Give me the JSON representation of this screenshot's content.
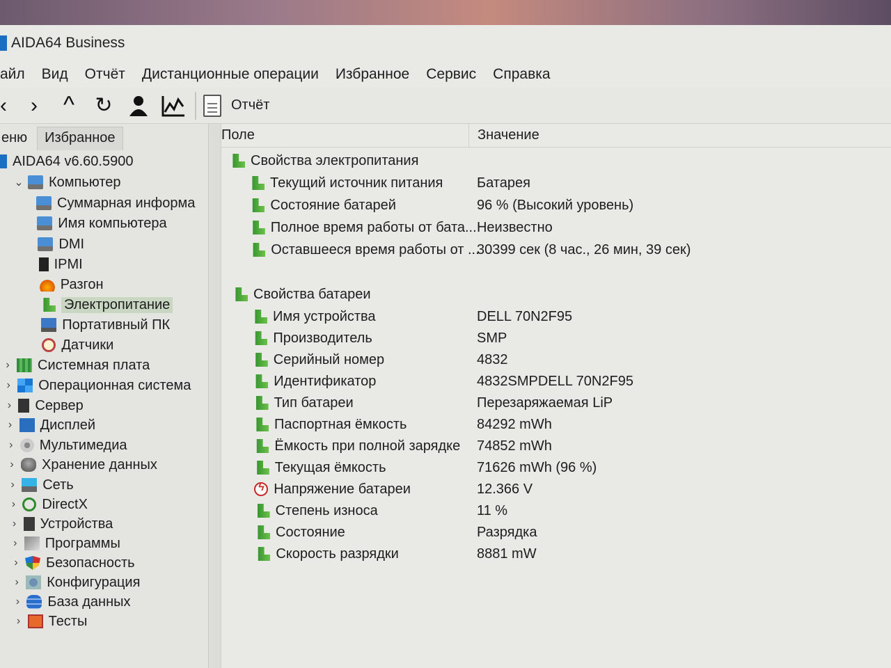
{
  "window": {
    "title": "AIDA64 Business"
  },
  "menu": [
    "айл",
    "Вид",
    "Отчёт",
    "Дистанционные операции",
    "Избранное",
    "Сервис",
    "Справка"
  ],
  "toolbar": {
    "back": "‹",
    "forward": "›",
    "up": "^",
    "refresh": "↻",
    "report_label": "Отчёт"
  },
  "left_tabs": {
    "menu": "еню",
    "favorites": "Избранное"
  },
  "tree": [
    {
      "label": "AIDA64 v6.60.5900",
      "icon": "aida-icon",
      "level": 0,
      "chevron": ""
    },
    {
      "label": "Компьютер",
      "icon": "computer-icon",
      "level": 1,
      "chevron": "⌄"
    },
    {
      "label": "Суммарная информа",
      "icon": "computer-icon",
      "level": 2,
      "chevron": ""
    },
    {
      "label": "Имя компьютера",
      "icon": "computer-icon",
      "level": 2,
      "chevron": ""
    },
    {
      "label": "DMI",
      "icon": "computer-icon",
      "level": 2,
      "chevron": ""
    },
    {
      "label": "IPMI",
      "icon": "ipmi-icon",
      "level": 2,
      "chevron": ""
    },
    {
      "label": "Разгон",
      "icon": "flame-icon",
      "level": 2,
      "chevron": ""
    },
    {
      "label": "Электропитание",
      "icon": "battery-icon",
      "level": 2,
      "chevron": "",
      "selected": true
    },
    {
      "label": "Портативный ПК",
      "icon": "laptop-icon",
      "level": 2,
      "chevron": ""
    },
    {
      "label": "Датчики",
      "icon": "gauge-icon",
      "level": 2,
      "chevron": ""
    },
    {
      "label": "Системная плата",
      "icon": "motherboard-icon",
      "level": 1,
      "chevron": "›"
    },
    {
      "label": "Операционная система",
      "icon": "windows-icon",
      "level": 1,
      "chevron": "›"
    },
    {
      "label": "Сервер",
      "icon": "server-icon",
      "level": 1,
      "chevron": "›"
    },
    {
      "label": "Дисплей",
      "icon": "display-icon",
      "level": 1,
      "chevron": "›"
    },
    {
      "label": "Мультимедиа",
      "icon": "multimedia-icon",
      "level": 1,
      "chevron": "›"
    },
    {
      "label": "Хранение данных",
      "icon": "storage-icon",
      "level": 1,
      "chevron": "›"
    },
    {
      "label": "Сеть",
      "icon": "network-icon",
      "level": 1,
      "chevron": "›"
    },
    {
      "label": "DirectX",
      "icon": "directx-icon",
      "level": 1,
      "chevron": "›"
    },
    {
      "label": "Устройства",
      "icon": "devices-icon",
      "level": 1,
      "chevron": "›"
    },
    {
      "label": "Программы",
      "icon": "programs-icon",
      "level": 1,
      "chevron": "›"
    },
    {
      "label": "Безопасность",
      "icon": "security-icon",
      "level": 1,
      "chevron": "›"
    },
    {
      "label": "Конфигурация",
      "icon": "config-icon",
      "level": 1,
      "chevron": "›"
    },
    {
      "label": "База данных",
      "icon": "database-icon",
      "level": 1,
      "chevron": "›"
    },
    {
      "label": "Тесты",
      "icon": "tests-icon",
      "level": 1,
      "chevron": "›"
    }
  ],
  "columns": {
    "field": "Поле",
    "value": "Значение"
  },
  "groups": [
    {
      "title": "Свойства электропитания",
      "rows": [
        {
          "field": "Текущий источник питания",
          "value": "Батарея",
          "icon": "battery-icon"
        },
        {
          "field": "Состояние батарей",
          "value": "96 % (Высокий уровень)",
          "icon": "battery-icon"
        },
        {
          "field": "Полное время работы от бата...",
          "value": "Неизвестно",
          "icon": "battery-icon"
        },
        {
          "field": "Оставшееся время работы от ...",
          "value": "30399 сек (8 час., 26 мин, 39 сек)",
          "icon": "battery-icon"
        }
      ]
    },
    {
      "title": "Свойства батареи",
      "rows": [
        {
          "field": "Имя устройства",
          "value": "DELL 70N2F95",
          "icon": "battery-icon"
        },
        {
          "field": "Производитель",
          "value": "SMP",
          "icon": "battery-icon"
        },
        {
          "field": "Серийный номер",
          "value": "4832",
          "icon": "battery-icon"
        },
        {
          "field": "Идентификатор",
          "value": "4832SMPDELL 70N2F95",
          "icon": "battery-icon"
        },
        {
          "field": "Тип батареи",
          "value": "Перезаряжаемая LiP",
          "icon": "battery-icon"
        },
        {
          "field": "Паспортная ёмкость",
          "value": "84292 mWh",
          "icon": "battery-icon"
        },
        {
          "field": "Ёмкость при полной зарядке",
          "value": "74852 mWh",
          "icon": "battery-icon"
        },
        {
          "field": "Текущая ёмкость",
          "value": "71626 mWh  (96 %)",
          "icon": "battery-icon"
        },
        {
          "field": "Напряжение батареи",
          "value": "12.366 V",
          "icon": "voltage-icon"
        },
        {
          "field": "Степень износа",
          "value": "11 %",
          "icon": "battery-icon"
        },
        {
          "field": "Состояние",
          "value": "Разрядка",
          "icon": "battery-icon"
        },
        {
          "field": "Скорость разрядки",
          "value": "8881 mW",
          "icon": "battery-icon"
        }
      ]
    }
  ]
}
